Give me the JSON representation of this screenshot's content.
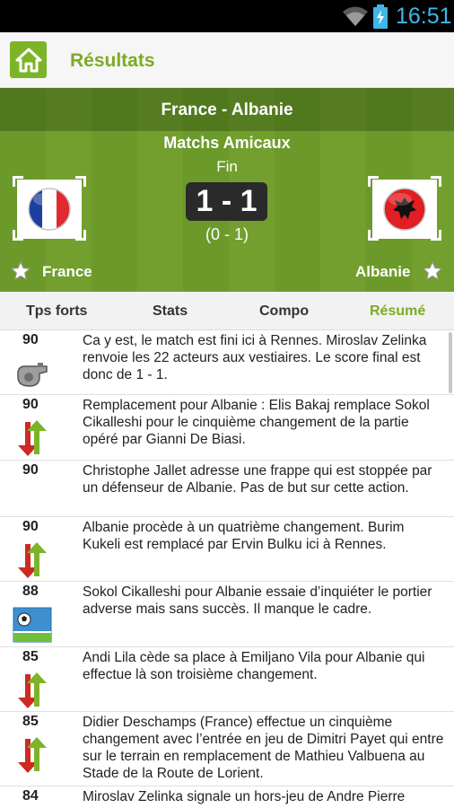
{
  "status_bar": {
    "time": "16:51",
    "icons": [
      "wifi-icon",
      "battery-charging-icon"
    ]
  },
  "app_bar": {
    "title": "Résultats",
    "home_icon": "home-icon"
  },
  "match": {
    "title": "France - Albanie",
    "competition": "Matchs Amicaux",
    "status": "Fin",
    "score": "1 - 1",
    "halftime": "(0 - 1)",
    "home": {
      "name": "France",
      "flag": "france-flag"
    },
    "away": {
      "name": "Albanie",
      "flag": "albania-flag"
    }
  },
  "tabs": [
    {
      "label": "Tps forts",
      "active": false
    },
    {
      "label": "Stats",
      "active": false
    },
    {
      "label": "Compo",
      "active": false
    },
    {
      "label": "Résumé",
      "active": true
    }
  ],
  "colors": {
    "accent": "#7cab24",
    "pitch": "#6c9a2a",
    "score_bg": "#2a2a2a"
  },
  "events": [
    {
      "minute": "90",
      "icon": "whistle-icon",
      "text": "Ca y est, le match est fini ici à Rennes. Miroslav Zelinka renvoie les 22 acteurs aux vestiaires. Le score final est donc de 1 - 1."
    },
    {
      "minute": "90",
      "icon": "substitution-icon",
      "text": "Remplacement pour Albanie : Elis Bakaj remplace Sokol Cikalleshi pour le cinquième changement de la partie opéré par Gianni De Biasi."
    },
    {
      "minute": "90",
      "icon": "",
      "text": "Christophe Jallet adresse une frappe qui est stoppée par un défenseur de Albanie. Pas de but sur cette action."
    },
    {
      "minute": "90",
      "icon": "substitution-icon",
      "text": "Albanie procède à un quatrième changement. Burim Kukeli est remplacé par Ervin Bulku ici à Rennes."
    },
    {
      "minute": "88",
      "icon": "shot-icon",
      "text": "Sokol Cikalleshi pour Albanie essaie d’inquiéter le portier adverse mais sans succès. Il manque le cadre."
    },
    {
      "minute": "85",
      "icon": "substitution-icon",
      "text": "Andi Lila cède sa place à Emiljano Vila pour Albanie qui effectue là son troisième changement."
    },
    {
      "minute": "85",
      "icon": "substitution-icon",
      "text": "Didier Deschamps (France) effectue un cinquième changement avec l’entrée en jeu de Dimitri Payet qui entre sur le terrain en remplacement de Mathieu Valbuena au Stade de la Route de Lorient."
    },
    {
      "minute": "84",
      "icon": "",
      "text": "Miroslav Zelinka signale un hors-jeu de Andre Pierre"
    }
  ]
}
